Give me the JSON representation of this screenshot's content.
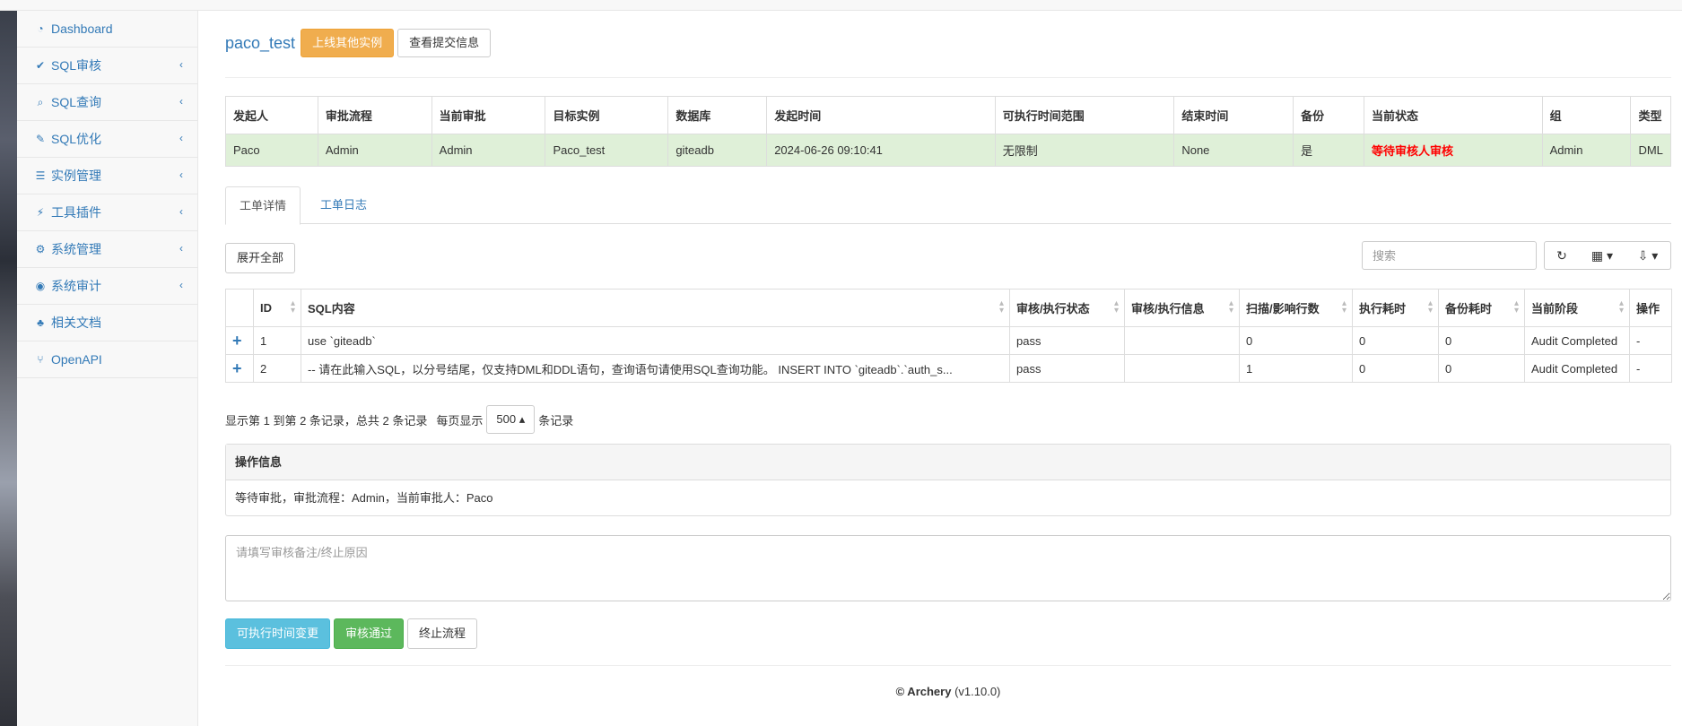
{
  "sidebar": {
    "items": [
      {
        "label": "Dashboard",
        "icon": "dashboard-icon",
        "glyph": "◔",
        "has_children": false
      },
      {
        "label": "SQL审核",
        "icon": "check-icon",
        "glyph": "✔",
        "has_children": true
      },
      {
        "label": "SQL查询",
        "icon": "search-icon",
        "glyph": "⌕",
        "has_children": true
      },
      {
        "label": "SQL优化",
        "icon": "wrench-icon",
        "glyph": "✎",
        "has_children": true
      },
      {
        "label": "实例管理",
        "icon": "database-icon",
        "glyph": "☰",
        "has_children": true
      },
      {
        "label": "工具插件",
        "icon": "plug-icon",
        "glyph": "⚡",
        "has_children": true
      },
      {
        "label": "系统管理",
        "icon": "cogs-icon",
        "glyph": "⚙",
        "has_children": true
      },
      {
        "label": "系统审计",
        "icon": "eye-icon",
        "glyph": "◉",
        "has_children": true
      },
      {
        "label": "相关文档",
        "icon": "sitemap-icon",
        "glyph": "♣",
        "has_children": false
      },
      {
        "label": "OpenAPI",
        "icon": "code-fork-icon",
        "glyph": "⑂",
        "has_children": false
      }
    ],
    "chevron": "‹"
  },
  "header": {
    "title": "paco_test",
    "online_btn": "上线其他实例",
    "view_btn": "查看提交信息"
  },
  "info_table": {
    "headers": [
      "发起人",
      "审批流程",
      "当前审批",
      "目标实例",
      "数据库",
      "发起时间",
      "可执行时间范围",
      "结束时间",
      "备份",
      "当前状态",
      "组",
      "类型"
    ],
    "row": [
      "Paco",
      "Admin",
      "Admin",
      "Paco_test",
      "giteadb",
      "2024-06-26 09:10:41",
      "无限制",
      "None",
      "是",
      "等待审核人审核",
      "Admin",
      "DML"
    ],
    "status_color": "#ff0000"
  },
  "tabs": {
    "detail": "工单详情",
    "log": "工单日志"
  },
  "toolbar": {
    "expand_btn": "展开全部",
    "search_placeholder": "搜索",
    "refresh_glyph": "↻",
    "columns_glyph": "▦ ▾",
    "export_glyph": "⇩ ▾"
  },
  "sql_table": {
    "headers": [
      "",
      "ID",
      "SQL内容",
      "审核/执行状态",
      "审核/执行信息",
      "扫描/影响行数",
      "执行耗时",
      "备份耗时",
      "当前阶段",
      "操作"
    ],
    "rows": [
      {
        "expand": "+",
        "id": "1",
        "sql": "use `giteadb`",
        "status": "pass",
        "info": "",
        "rows": "0",
        "exec": "0",
        "backup": "0",
        "stage": "Audit Completed",
        "op": "-"
      },
      {
        "expand": "+",
        "id": "2",
        "sql": "-- 请在此输入SQL，以分号结尾，仅支持DML和DDL语句，查询语句请使用SQL查询功能。 INSERT INTO `giteadb`.`auth_s...",
        "status": "pass",
        "info": "",
        "rows": "1",
        "exec": "0",
        "backup": "0",
        "stage": "Audit Completed",
        "op": "-"
      }
    ]
  },
  "pager": {
    "summary": "显示第 1 到第 2 条记录，总共 2 条记录",
    "per_page_prefix": "每页显示",
    "per_page_value": "500 ▴",
    "per_page_suffix": "条记录"
  },
  "panel": {
    "title": "操作信息",
    "body": "等待审批，审批流程：Admin，当前审批人：Paco"
  },
  "remark": {
    "placeholder": "请填写审核备注/终止原因"
  },
  "actions": {
    "change_time": "可执行时间变更",
    "approve": "审核通过",
    "terminate": "终止流程"
  },
  "footer": {
    "brand": "© Archery",
    "version": "(v1.10.0)"
  }
}
